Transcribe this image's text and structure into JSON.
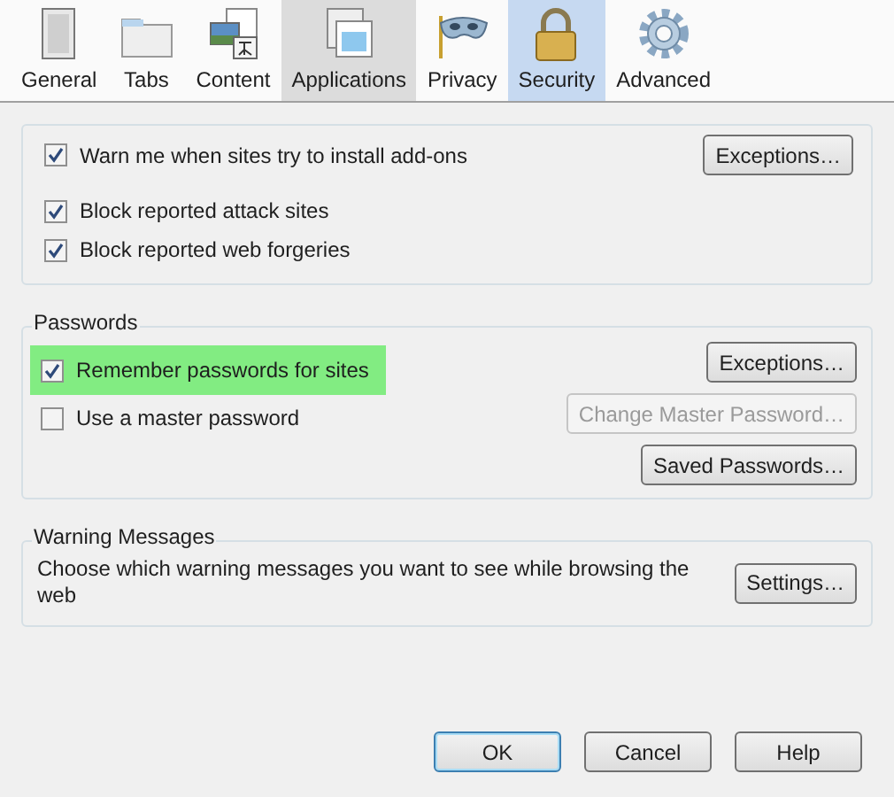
{
  "tabs": [
    {
      "label": "General",
      "kind": "general",
      "selected": false,
      "hovered": false
    },
    {
      "label": "Tabs",
      "kind": "tabs",
      "selected": false,
      "hovered": false
    },
    {
      "label": "Content",
      "kind": "content",
      "selected": false,
      "hovered": false
    },
    {
      "label": "Applications",
      "kind": "applications",
      "selected": false,
      "hovered": true
    },
    {
      "label": "Privacy",
      "kind": "privacy",
      "selected": false,
      "hovered": false
    },
    {
      "label": "Security",
      "kind": "security",
      "selected": true,
      "hovered": false
    },
    {
      "label": "Advanced",
      "kind": "advanced",
      "selected": false,
      "hovered": false
    }
  ],
  "addons_group": {
    "checkboxes": [
      {
        "label": "Warn me when sites try to install add-ons",
        "checked": true
      },
      {
        "label": "Block reported attack sites",
        "checked": true
      },
      {
        "label": "Block reported web forgeries",
        "checked": true
      }
    ],
    "button": {
      "label": "Exceptions…",
      "disabled": false
    }
  },
  "passwords_group": {
    "title": "Passwords",
    "checkboxes": [
      {
        "label": "Remember passwords for sites",
        "checked": true,
        "highlighted": true
      },
      {
        "label": "Use a master password",
        "checked": false,
        "highlighted": false
      }
    ],
    "buttons": [
      {
        "label": "Exceptions…",
        "disabled": false
      },
      {
        "label": "Change Master Password…",
        "disabled": true
      },
      {
        "label": "Saved Passwords…",
        "disabled": false
      }
    ]
  },
  "warning_group": {
    "title": "Warning Messages",
    "text": "Choose which warning messages you want to see while browsing the web",
    "button": {
      "label": "Settings…",
      "disabled": false
    }
  },
  "dialog_buttons": [
    {
      "label": "OK",
      "default": true
    },
    {
      "label": "Cancel",
      "default": false
    },
    {
      "label": "Help",
      "default": false
    }
  ]
}
